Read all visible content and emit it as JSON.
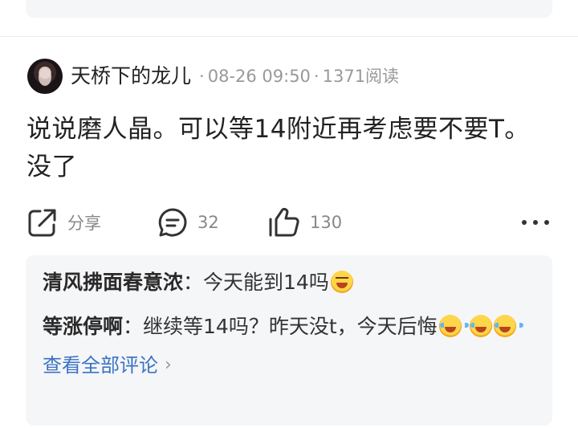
{
  "post": {
    "author": "天桥下的龙儿",
    "date": "08-26 09:50",
    "reads": "1371阅读",
    "separator": "·",
    "content": "说说磨人晶。可以等14附近再考虑要不要T。没了"
  },
  "actions": {
    "share_label": "分享",
    "comment_count": "32",
    "like_count": "130"
  },
  "comments": [
    {
      "author": "清风拂面春意浓",
      "colon": "：",
      "text": "今天能到14吗",
      "emoji": [
        "laughing-emoji"
      ]
    },
    {
      "author": "等涨停啊",
      "colon": "：",
      "text": "继续等14吗？昨天没t，今天后悔",
      "emoji": [
        "crying-laughing-emoji",
        "crying-laughing-emoji",
        "crying-laughing-emoji"
      ]
    }
  ],
  "view_all_label": "查看全部评论",
  "colors": {
    "link": "#3a73c4",
    "meta": "#999999",
    "card_bg": "#f5f6f8"
  }
}
